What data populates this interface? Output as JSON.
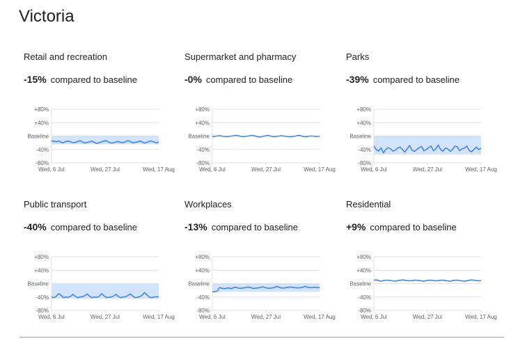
{
  "page": {
    "region": "Victoria",
    "compared_label": "compared to baseline"
  },
  "colors": {
    "line": "#4285f4",
    "band": "#d2e3fc",
    "grid": "#e0e0e0",
    "text": "#202124",
    "axis_text": "#5f6368"
  },
  "chart_data": [
    {
      "type": "line",
      "title": "Retail and recreation",
      "change": "-15%",
      "y_ticks": [
        "+80%",
        "+40%",
        "Baseline",
        "-40%",
        "-80%"
      ],
      "ylim": [
        -80,
        80
      ],
      "x_ticks": [
        "Wed, 6 Jul",
        "Wed, 27 Jul",
        "Wed, 17 Aug"
      ],
      "band": [
        -25,
        0
      ],
      "series": [
        {
          "values": [
            -14,
            -16,
            -17,
            -15,
            -19,
            -20,
            -16,
            -15,
            -17,
            -20,
            -19,
            -16,
            -14,
            -18,
            -21,
            -19,
            -17,
            -15,
            -19,
            -22,
            -20,
            -17,
            -15,
            -14,
            -18,
            -21,
            -20,
            -18,
            -16,
            -19,
            -20,
            -17,
            -14,
            -16,
            -20,
            -19,
            -18,
            -15,
            -17,
            -21,
            -19,
            -16,
            -15,
            -18,
            -20,
            -18
          ]
        }
      ]
    },
    {
      "type": "line",
      "title": "Supermarket and pharmacy",
      "change": "-0%",
      "y_ticks": [
        "+80%",
        "+40%",
        "Baseline",
        "-40%",
        "-80%"
      ],
      "ylim": [
        -80,
        80
      ],
      "x_ticks": [
        "Wed, 6 Jul",
        "Wed, 27 Jul",
        "Wed, 17 Aug"
      ],
      "band": null,
      "series": [
        {
          "values": [
            -2,
            -1,
            0,
            1,
            0,
            -1,
            -2,
            -1,
            0,
            1,
            2,
            1,
            -1,
            -2,
            -1,
            0,
            1,
            2,
            0,
            -2,
            -3,
            -1,
            0,
            2,
            1,
            -1,
            -2,
            -1,
            0,
            1,
            0,
            -1,
            -2,
            -2,
            -1,
            0,
            2,
            1,
            -1,
            -2,
            -1,
            0,
            0,
            -1,
            -1,
            -1
          ]
        }
      ]
    },
    {
      "type": "line",
      "title": "Parks",
      "change": "-39%",
      "y_ticks": [
        "+80%",
        "+40%",
        "Baseline",
        "-40%",
        "-80%"
      ],
      "ylim": [
        -80,
        80
      ],
      "x_ticks": [
        "Wed, 6 Jul",
        "Wed, 27 Jul",
        "Wed, 17 Aug"
      ],
      "band": [
        -55,
        0
      ],
      "series": [
        {
          "values": [
            -30,
            -40,
            -45,
            -35,
            -50,
            -40,
            -35,
            -38,
            -45,
            -42,
            -36,
            -33,
            -40,
            -48,
            -38,
            -28,
            -42,
            -46,
            -40,
            -35,
            -31,
            -44,
            -40,
            -35,
            -30,
            -44,
            -38,
            -27,
            -40,
            -45,
            -36,
            -38,
            -46,
            -40,
            -30,
            -32,
            -44,
            -38,
            -36,
            -30,
            -43,
            -47,
            -40,
            -33,
            -40,
            -36
          ]
        }
      ]
    },
    {
      "type": "line",
      "title": "Public transport",
      "change": "-40%",
      "y_ticks": [
        "+80%",
        "+40%",
        "Baseline",
        "-40%",
        "-80%"
      ],
      "ylim": [
        -80,
        80
      ],
      "x_ticks": [
        "Wed, 6 Jul",
        "Wed, 27 Jul",
        "Wed, 17 Aug"
      ],
      "band": [
        -45,
        0
      ],
      "series": [
        {
          "values": [
            -40,
            -42,
            -38,
            -30,
            -35,
            -42,
            -40,
            -41,
            -38,
            -32,
            -38,
            -42,
            -40,
            -39,
            -36,
            -31,
            -38,
            -42,
            -40,
            -41,
            -38,
            -30,
            -36,
            -42,
            -41,
            -40,
            -37,
            -32,
            -38,
            -42,
            -40,
            -39,
            -36,
            -31,
            -37,
            -42,
            -41,
            -39,
            -35,
            -27,
            -33,
            -40,
            -42,
            -40,
            -39,
            -40
          ]
        }
      ]
    },
    {
      "type": "line",
      "title": "Workplaces",
      "change": "-13%",
      "y_ticks": [
        "+80%",
        "+40%",
        "Baseline",
        "-40%",
        "-80%"
      ],
      "ylim": [
        -80,
        80
      ],
      "x_ticks": [
        "Wed, 6 Jul",
        "Wed, 27 Jul",
        "Wed, 17 Aug"
      ],
      "band": [
        -25,
        0
      ],
      "series": [
        {
          "values": [
            -25,
            -24,
            -23,
            -12,
            -14,
            -15,
            -14,
            -13,
            -15,
            -12,
            -11,
            -14,
            -14,
            -13,
            -12,
            -10,
            -12,
            -14,
            -14,
            -13,
            -12,
            -9,
            -12,
            -13,
            -14,
            -13,
            -12,
            -8,
            -11,
            -13,
            -13,
            -12,
            -11,
            -10,
            -12,
            -12,
            -13,
            -12,
            -11,
            -8,
            -11,
            -12,
            -12,
            -11,
            -12,
            -12
          ]
        }
      ]
    },
    {
      "type": "line",
      "title": "Residential",
      "change": "+9%",
      "y_ticks": [
        "+80%",
        "+40%",
        "Baseline",
        "-40%",
        "-80%"
      ],
      "ylim": [
        -80,
        80
      ],
      "x_ticks": [
        "Wed, 6 Jul",
        "Wed, 27 Jul",
        "Wed, 17 Aug"
      ],
      "band": null,
      "series": [
        {
          "values": [
            10,
            11,
            9,
            7,
            9,
            10,
            10,
            9,
            8,
            7,
            9,
            10,
            11,
            10,
            9,
            8,
            9,
            10,
            10,
            9,
            8,
            7,
            9,
            10,
            10,
            9,
            8,
            9,
            10,
            10,
            9,
            8,
            7,
            9,
            10,
            10,
            9,
            8,
            7,
            8,
            10,
            11,
            10,
            9,
            8,
            9
          ]
        }
      ]
    }
  ]
}
